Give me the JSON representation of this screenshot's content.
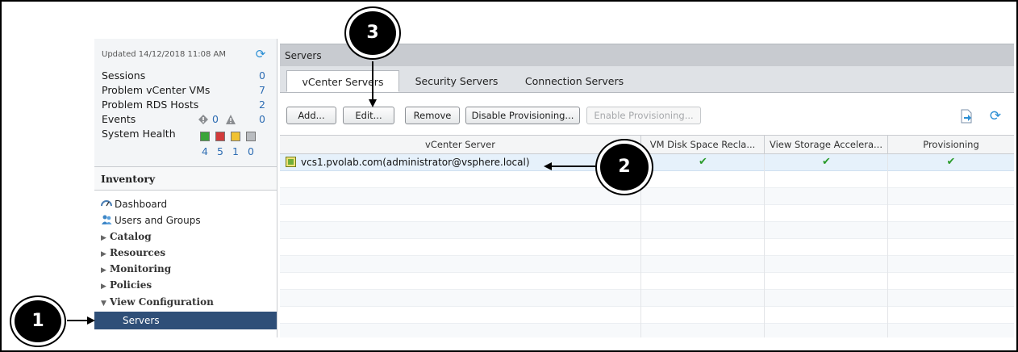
{
  "status": {
    "updated": "Updated 14/12/2018 11:08 AM",
    "rows": [
      {
        "label": "Sessions",
        "value": "0"
      },
      {
        "label": "Problem vCenter VMs",
        "value": "7"
      },
      {
        "label": "Problem RDS Hosts",
        "value": "2"
      }
    ],
    "events": {
      "label": "Events",
      "errors": "0",
      "warnings": "0"
    },
    "health": {
      "label": "System Health",
      "counts": [
        "4",
        "5",
        "1",
        "0"
      ],
      "colors": [
        "#3aa53a",
        "#d23b3b",
        "#f1c232",
        "#b9bcc0"
      ]
    }
  },
  "inventory": {
    "title": "Inventory",
    "items": [
      {
        "label": "Dashboard",
        "icon": "dashboard-icon"
      },
      {
        "label": "Users and Groups",
        "icon": "users-icon"
      },
      {
        "label": "Catalog"
      },
      {
        "label": "Resources"
      },
      {
        "label": "Monitoring"
      },
      {
        "label": "Policies"
      },
      {
        "label": "View Configuration"
      },
      {
        "label": "Servers"
      }
    ]
  },
  "main": {
    "title": "Servers",
    "tabs": [
      "vCenter Servers",
      "Security Servers",
      "Connection Servers"
    ],
    "buttons": {
      "add": "Add...",
      "edit": "Edit...",
      "remove": "Remove",
      "disable": "Disable Provisioning...",
      "enable": "Enable Provisioning..."
    },
    "columns": [
      "vCenter Server",
      "VM Disk Space Recla...",
      "View Storage Accelera...",
      "Provisioning"
    ],
    "rows": [
      {
        "server": "vcs1.pvolab.com(administrator@vsphere.local)",
        "reclaim": "✔",
        "accel": "✔",
        "prov": "✔"
      }
    ]
  },
  "annotations": [
    "1",
    "2",
    "3"
  ],
  "colors": {
    "selection": "#2f4f78",
    "selected_row": "#e6f1fb",
    "check": "#2b9b2b"
  }
}
